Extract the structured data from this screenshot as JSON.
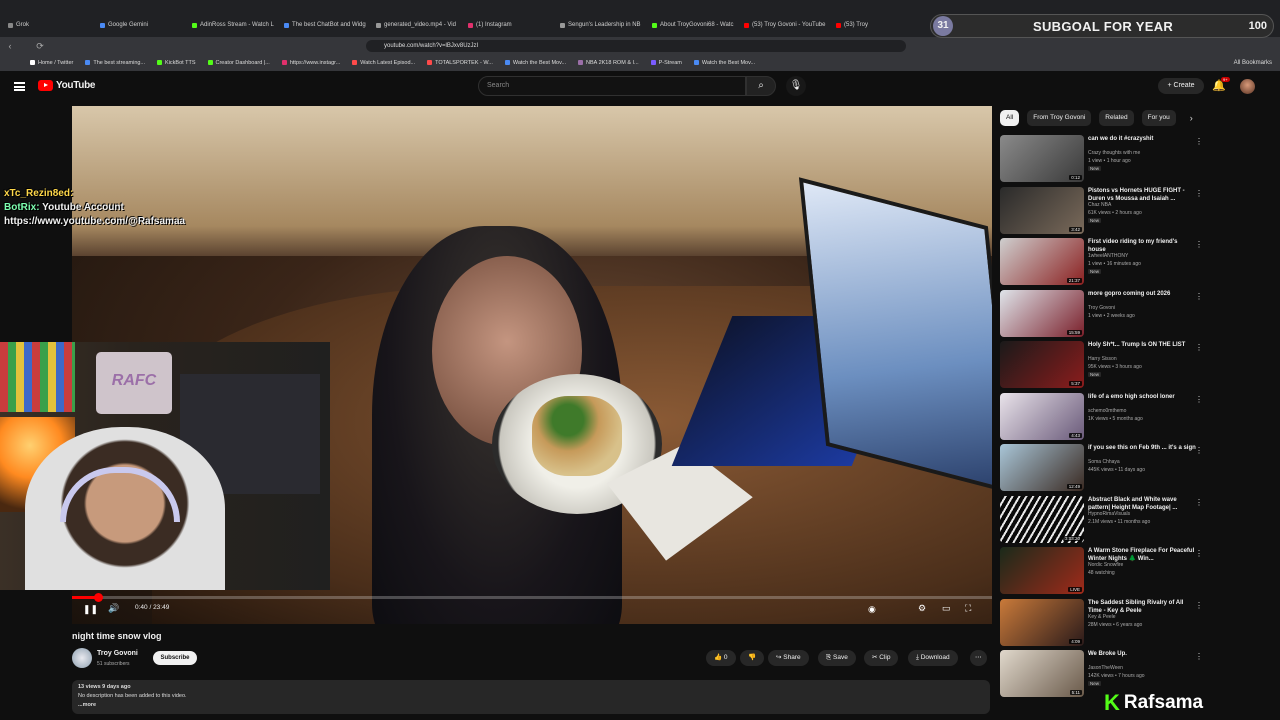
{
  "browser": {
    "tabs": [
      {
        "label": "Grok",
        "color": "#888888"
      },
      {
        "label": "Google Gemini",
        "color": "#4a8af4"
      },
      {
        "label": "AdinRoss Stream - Watch L",
        "color": "#53fc18"
      },
      {
        "label": "The best ChatBot and Widg",
        "color": "#4a8af4"
      },
      {
        "label": "generated_video.mp4 - Vid",
        "color": "#999999"
      },
      {
        "label": "(1) Instagram",
        "color": "#e1306c"
      },
      {
        "label": "Sengun's Leadership in NB",
        "color": "#999999"
      },
      {
        "label": "About TroyGovoni68 - Watc",
        "color": "#53fc18"
      },
      {
        "label": "(53) Troy Govoni - YouTube",
        "color": "#ff0000"
      },
      {
        "label": "(53) Troy",
        "color": "#ff0000"
      }
    ],
    "url": "youtube.com/watch?v=lBJxv8UzJzI",
    "bookmarks": [
      {
        "label": "Home / Twitter",
        "color": "#ffffff"
      },
      {
        "label": "The best streaming...",
        "color": "#4a8af4"
      },
      {
        "label": "KickBot TTS",
        "color": "#53fc18"
      },
      {
        "label": "Creator Dashboard |...",
        "color": "#53fc18"
      },
      {
        "label": "https://www.instagr...",
        "color": "#e1306c"
      },
      {
        "label": "Watch Latest Episod...",
        "color": "#ff4a4a"
      },
      {
        "label": "TOTALSPORTEK - W...",
        "color": "#ff4a4a"
      },
      {
        "label": "Watch the Best Mov...",
        "color": "#4a8af4"
      },
      {
        "label": "NBA 2K18 ROM & I...",
        "color": "#9b6fa8"
      },
      {
        "label": "P-Stream",
        "color": "#7b5cff"
      },
      {
        "label": "Watch the Best Mov...",
        "color": "#4a8af4"
      }
    ],
    "all_bookmarks": "All Bookmarks"
  },
  "overlay_goal": {
    "left": "31",
    "text": "SUBGOAL FOR YEAR",
    "right": "100"
  },
  "youtube": {
    "logo": "YouTube",
    "search_placeholder": "Search",
    "create": "Create",
    "notif_badge": "9+"
  },
  "chat": [
    {
      "user": "xTc_Rezin8ed:",
      "message": ""
    },
    {
      "user": "BotRix:",
      "message": "Youtube Account"
    },
    {
      "user": "",
      "message": "https://www.youtube.com/@Rafsamaa"
    }
  ],
  "webcam": {
    "logo": "RAFC"
  },
  "player": {
    "time": "0:40 / 23:49",
    "progress": 0.028
  },
  "video": {
    "title": "night time snow vlog",
    "channel": "Troy Govoni",
    "subscribers": "51 subscribers",
    "subscribe": "Subscribe",
    "likes": "0",
    "share": "Share",
    "save": "Save",
    "clip": "Clip",
    "download": "Download",
    "meta": "13 views  9 days ago",
    "description": "No description has been added to this video.",
    "more": "...more"
  },
  "chips": [
    "All",
    "From Troy Govoni",
    "Related",
    "For you"
  ],
  "recommendations": [
    {
      "title": "can we do it #crazyshit",
      "channel": "Crazy thoughts with me",
      "views": "1 view • 1 hour ago",
      "badge": "New",
      "duration": "0:12",
      "thumb": "linear-gradient(135deg,#8a8a8a,#3a3a3a)"
    },
    {
      "title": "Pistons vs Hornets HUGE FIGHT - Duren vs Moussa and Isaiah ...",
      "channel": "Chaz NBA",
      "views": "61K views • 2 hours ago",
      "badge": "New",
      "duration": "3:42",
      "thumb": "linear-gradient(135deg,#2a2a2a,#7a6a5a)"
    },
    {
      "title": "First video riding to my friend's house",
      "channel": "1wheelANTHONY",
      "views": "1 view • 16 minutes ago",
      "badge": "New",
      "duration": "21:37",
      "thumb": "linear-gradient(135deg,#cfcfcf,#8b2020)"
    },
    {
      "title": "more gopro coming out 2026",
      "channel": "Troy Govoni",
      "views": "1 view • 2 weeks ago",
      "badge": "",
      "duration": "15:59",
      "thumb": "linear-gradient(135deg,#dfe4ea,#7a1f2a)"
    },
    {
      "title": "Holy Sh*t... Trump Is ON THE LIST",
      "channel": "Harry Sisson",
      "views": "95K views • 3 hours ago",
      "badge": "New",
      "duration": "5:37",
      "thumb": "linear-gradient(135deg,#1a1a1a,#8b1c1c)"
    },
    {
      "title": "life of a emo high school loner",
      "channel": "schemo0mthemo",
      "views": "1K views • 5 months ago",
      "badge": "",
      "duration": "4:43",
      "thumb": "linear-gradient(135deg,#e9e3ea,#6a5a7a)"
    },
    {
      "title": "if you see this on Feb 9th ... it's a sign",
      "channel": "Soma Chhaya",
      "views": "445K views • 11 days ago",
      "badge": "",
      "duration": "12:49",
      "thumb": "linear-gradient(135deg,#a9c6d8,#3a2a22)"
    },
    {
      "title": "Abstract Black and White wave pattern| Height Map Footage| ...",
      "channel": "HypnoRimaVisuals",
      "views": "2.1M views • 11 months ago",
      "badge": "",
      "duration": "3:03:20",
      "thumb": "repeating-linear-gradient(120deg,#0a0a0a 0 4px,#e8e8e8 4px 6px)"
    },
    {
      "title": "A Warm Stone Fireplace For Peaceful Winter Nights 🌲 Win...",
      "channel": "Nordic Snowfire",
      "views": "48 watching",
      "badge": "",
      "duration": "LIVE",
      "thumb": "linear-gradient(135deg,#1a2a1a,#a02a1a)"
    },
    {
      "title": "The Saddest Sibling Rivalry of All Time - Key & Peele",
      "channel": "Key & Peele",
      "views": "28M views • 6 years ago",
      "badge": "",
      "duration": "4:09",
      "thumb": "linear-gradient(135deg,#c97a3a,#2a1a1a)"
    },
    {
      "title": "We Broke Up.",
      "channel": "JasonTheWeen",
      "views": "142K views • 7 hours ago",
      "badge": "New",
      "duration": "5:11",
      "thumb": "linear-gradient(135deg,#e0d8cc,#6a5a4a)"
    }
  ],
  "brand": {
    "k": "K",
    "name": "Rafsama"
  }
}
